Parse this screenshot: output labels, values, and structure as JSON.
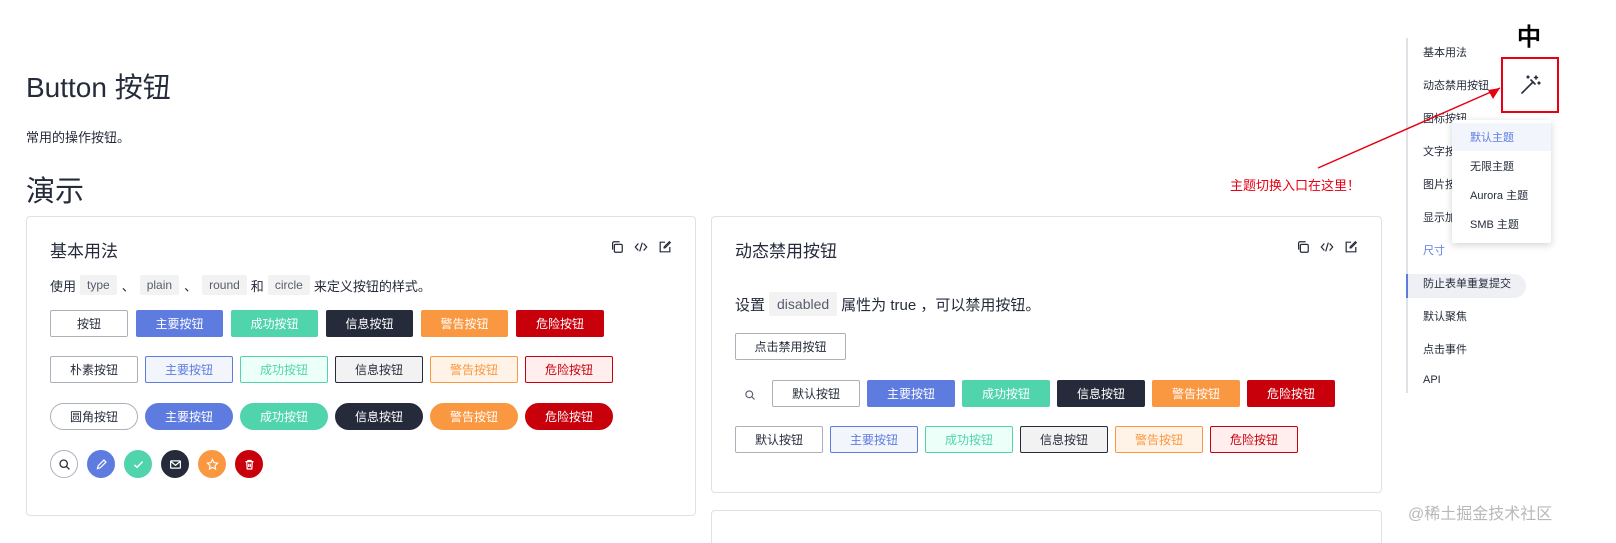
{
  "page": {
    "title": "Button 按钮",
    "description": "常用的操作按钮。",
    "section_title": "演示"
  },
  "card_basic": {
    "title": "基本用法",
    "tools": [
      "copy-icon",
      "code-icon",
      "edit-icon"
    ],
    "desc": {
      "prefix": "使用",
      "code1": "type",
      "sep1": "、",
      "code2": "plain",
      "sep2": "、",
      "code3": "round",
      "and": "和",
      "code4": "circle",
      "suffix": "来定义按钮的样式。"
    },
    "row_default": [
      "按钮",
      "主要按钮",
      "成功按钮",
      "信息按钮",
      "警告按钮",
      "危险按钮"
    ],
    "row_plain": [
      "朴素按钮",
      "主要按钮",
      "成功按钮",
      "信息按钮",
      "警告按钮",
      "危险按钮"
    ],
    "row_round": [
      "圆角按钮",
      "主要按钮",
      "成功按钮",
      "信息按钮",
      "警告按钮",
      "危险按钮"
    ],
    "row_circle_icons": [
      "search-icon",
      "edit-icon",
      "check-icon",
      "mail-icon",
      "star-icon",
      "delete-icon"
    ]
  },
  "card_disabled": {
    "title": "动态禁用按钮",
    "tools": [
      "copy-icon",
      "code-icon",
      "edit-icon"
    ],
    "desc": {
      "prefix": "设置",
      "code": "disabled",
      "suffix": "属性为 true ，可以禁用按钮。"
    },
    "toggle_button": "点击禁用按钮",
    "row_solid": [
      "默认按钮",
      "主要按钮",
      "成功按钮",
      "信息按钮",
      "警告按钮",
      "危险按钮"
    ],
    "row_plain": [
      "默认按钮",
      "主要按钮",
      "成功按钮",
      "信息按钮",
      "警告按钮",
      "危险按钮"
    ]
  },
  "toc": {
    "items": [
      "基本用法",
      "动态禁用按钮",
      "图标按钮",
      "文字按",
      "图片按",
      "显示加",
      "尺寸",
      "防止表单重复提交",
      "默认聚焦",
      "点击事件",
      "API"
    ],
    "active_index": 6
  },
  "theme": {
    "lang_label": "中",
    "icon": "magic-wand-icon",
    "options": [
      "默认主题",
      "无限主题",
      "Aurora 主题",
      "SMB 主题"
    ],
    "active_index": 0
  },
  "annotation": {
    "text": "主题切换入口在这里！",
    "color": "#e60012"
  },
  "watermark": "@稀土掘金技术社区",
  "colors": {
    "primary": "#5e7ce0",
    "success": "#50d4ab",
    "info": "#252b3a",
    "warning": "#fa9841",
    "danger": "#c7000b"
  }
}
